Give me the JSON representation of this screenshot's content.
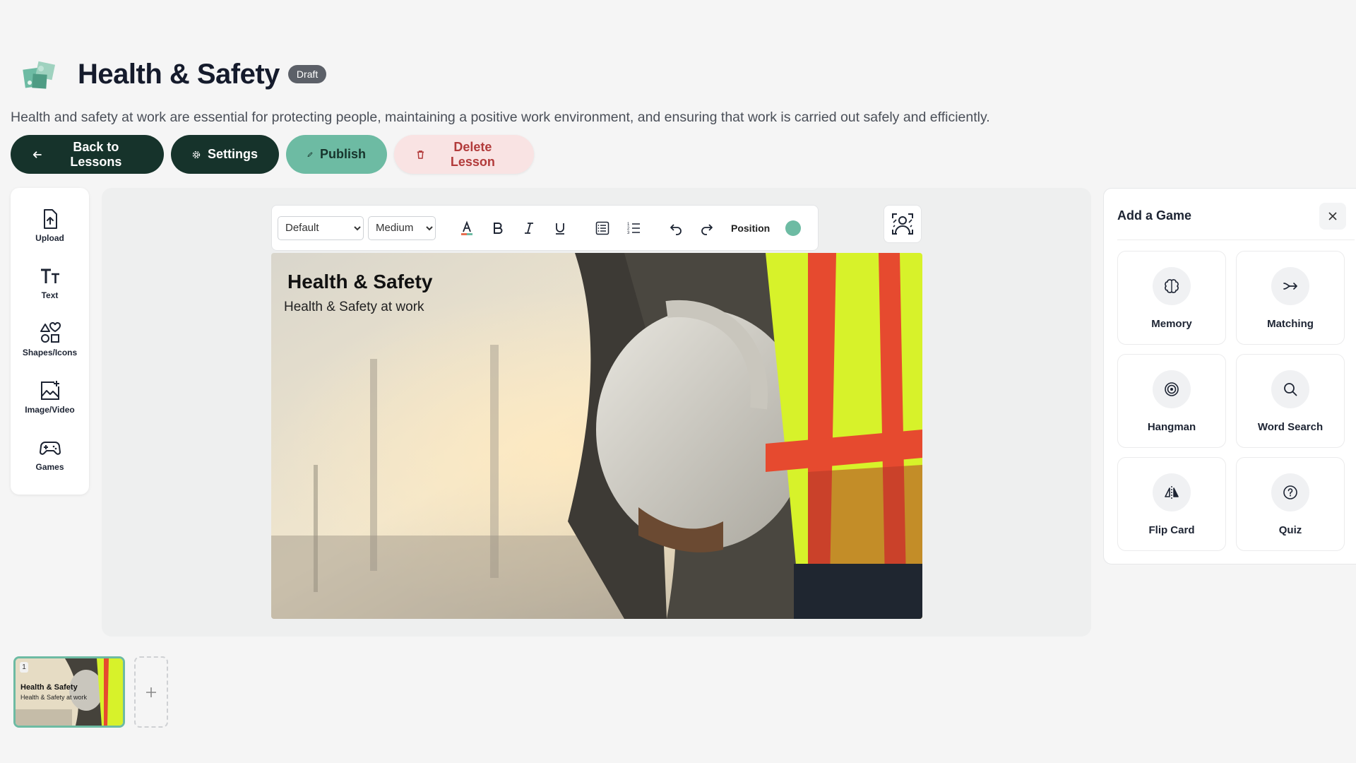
{
  "lesson": {
    "title": "Health & Safety",
    "status": "Draft",
    "description": "Health and safety at work are essential for protecting people, maintaining a positive work environment, and ensuring that work is carried out safely and efficiently."
  },
  "actions": {
    "back_label": "Back to Lessons",
    "settings_label": "Settings",
    "publish_label": "Publish",
    "delete_label": "Delete Lesson"
  },
  "tools": [
    {
      "label": "Upload",
      "icon": "upload-icon"
    },
    {
      "label": "Text",
      "icon": "text-icon"
    },
    {
      "label": "Shapes/Icons",
      "icon": "shapes-icon"
    },
    {
      "label": "Image/Video",
      "icon": "image-icon"
    },
    {
      "label": "Games",
      "icon": "gamepad-icon"
    }
  ],
  "toolbar": {
    "font_family": "Default",
    "font_size": "Medium",
    "position_label": "Position",
    "color": "#6dbba3"
  },
  "slide": {
    "title": "Health & Safety",
    "subtitle": "Health & Safety at work"
  },
  "game_panel": {
    "title": "Add a Game",
    "games": [
      {
        "label": "Memory",
        "icon": "brain-icon"
      },
      {
        "label": "Matching",
        "icon": "arrows-merge-icon"
      },
      {
        "label": "Hangman",
        "icon": "target-icon"
      },
      {
        "label": "Word Search",
        "icon": "search-icon"
      },
      {
        "label": "Flip Card",
        "icon": "flip-icon"
      },
      {
        "label": "Quiz",
        "icon": "question-icon"
      }
    ]
  },
  "thumbnails": [
    {
      "number": "1",
      "title": "Health & Safety",
      "subtitle": "Health & Safety at work"
    }
  ],
  "colors": {
    "accent": "#6dbba3",
    "dark_button": "#16332b",
    "delete_bg": "#f9e3e3",
    "delete_text": "#b23b3b"
  }
}
